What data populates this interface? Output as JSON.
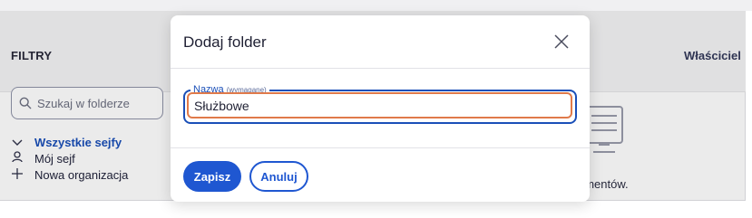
{
  "background": {
    "filters_title": "FILTRY",
    "owner_column": "Właściciel",
    "search_placeholder": "Szukaj w folderze",
    "tree": {
      "all_vaults": "Wszystkie sejfy",
      "my_vault": "Mój sejf",
      "new_org": "Nowa organizacja"
    },
    "empty_text": "ementów."
  },
  "dialog": {
    "title": "Dodaj folder",
    "close_icon": "close-icon",
    "field": {
      "label": "Nazwa",
      "required_hint": "(wymagane)",
      "value": "Służbowe"
    },
    "save_label": "Zapisz",
    "cancel_label": "Anuluj"
  },
  "colors": {
    "accent": "#1f57d1",
    "focus_ring": "#e07a4a"
  }
}
